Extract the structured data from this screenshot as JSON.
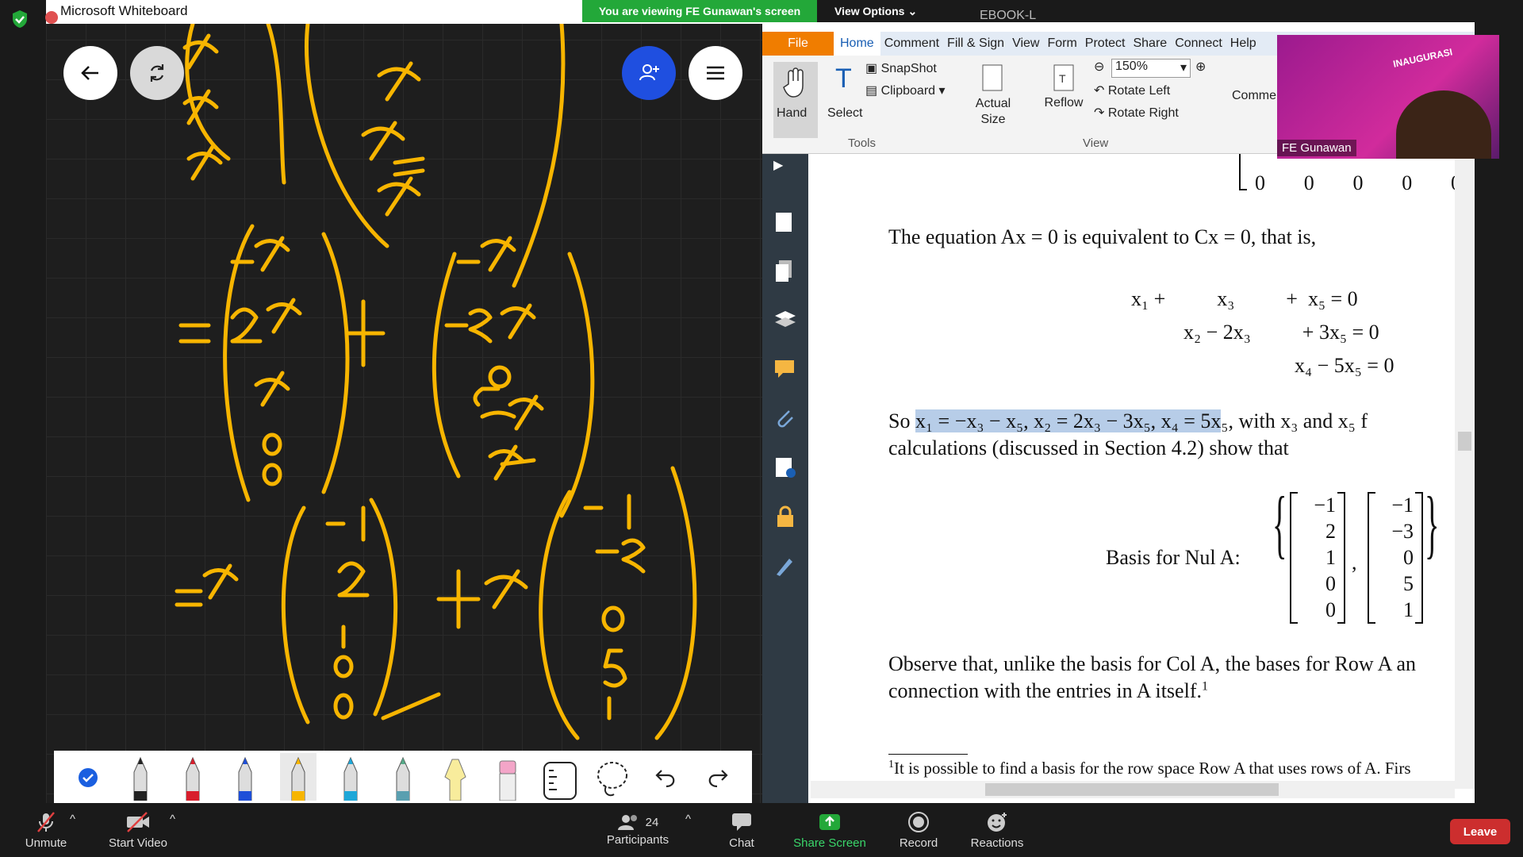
{
  "zoom": {
    "share_banner": "You are viewing FE Gunawan's screen",
    "view_options": "View Options",
    "bottom": {
      "unmute": "Unmute",
      "start_video": "Start Video",
      "participants": "Participants",
      "participants_count": "24",
      "chat": "Chat",
      "share_screen": "Share Screen",
      "record": "Record",
      "reactions": "Reactions",
      "leave": "Leave"
    },
    "video_name": "FE Gunawan",
    "video_banner": "INAUGURASI"
  },
  "whiteboard": {
    "title": "Microsoft Whiteboard",
    "ink_color": "#f7b500"
  },
  "pdf": {
    "menu": [
      "File",
      "Home",
      "Comment",
      "Fill & Sign",
      "View",
      "Form",
      "Protect",
      "Share",
      "Connect",
      "Help"
    ],
    "tab_label": "EBOOK-L",
    "ribbon": {
      "hand": "Hand",
      "select": "Select",
      "snapshot": "SnapShot",
      "clipboard": "Clipboard",
      "actual_size": "Actual Size",
      "reflow": "Reflow",
      "zoom": "150%",
      "rotate_left": "Rotate Left",
      "rotate_right": "Rotate Right",
      "comment": "Comme",
      "group_tools": "Tools",
      "group_view": "View"
    },
    "content": {
      "top_row": [
        "0",
        "0",
        "0",
        "0",
        "0"
      ],
      "line1": "The equation Ax = 0 is equivalent to Cx = 0, that is,",
      "eq1": "x₁ +          x₃          +  x₅ = 0",
      "eq2": "x₂ − 2x₃          + 3x₅ = 0",
      "eq3": "x₄ − 5x₅ = 0",
      "so_prefix": "So ",
      "so_highlight": "x₁ = −x₃ − x₅, x₂ = 2x₃ − 3x₅, x₄ = 5x",
      "so_suffix": "₅, with x₃ and x₅ f",
      "line_calc": "calculations (discussed in Section 4.2) show that",
      "basis_label": "Basis for Nul A:",
      "vec1": [
        "−1",
        "2",
        "1",
        "0",
        "0"
      ],
      "vec2": [
        "−1",
        "−3",
        "0",
        "5",
        "1"
      ],
      "observe1": "Observe that, unlike the basis for Col A, the bases for Row A an",
      "observe2": "connection with the entries in A itself.",
      "observe2_sup": "1",
      "footnote": "It is possible to find a basis for the row space Row A that uses rows of A. Firs",
      "footnote_mark": "1"
    }
  }
}
